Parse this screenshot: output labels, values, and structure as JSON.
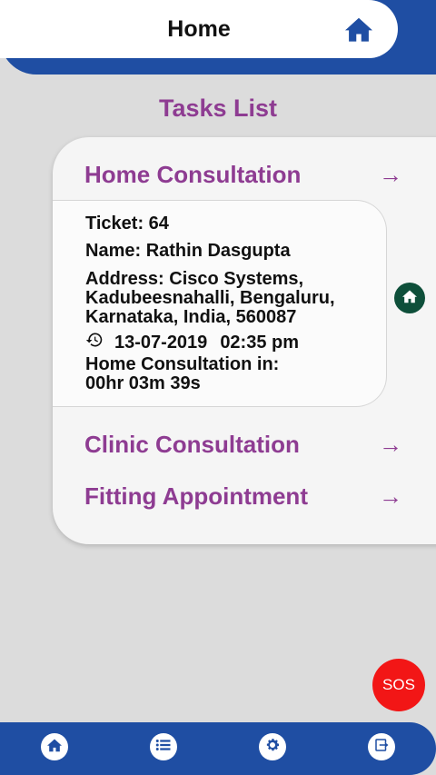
{
  "header": {
    "title": "Home",
    "home_icon": "home-icon"
  },
  "tasks": {
    "title": "Tasks List",
    "items": [
      {
        "label": "Home Consultation",
        "arrow": "→"
      },
      {
        "label": "Clinic Consultation",
        "arrow": "→"
      },
      {
        "label": "Fitting Appointment",
        "arrow": "→"
      }
    ]
  },
  "ticket": {
    "ticket": "Ticket: 64",
    "name": "Name: Rathin Dasgupta",
    "address_lines": [
      "Address: Cisco Systems,",
      "Kadubeesnahalli, Bengaluru,",
      "Karnataka, India, 560087"
    ],
    "date": "13-07-2019",
    "time": "02:35 pm",
    "countdown_label": "Home Consultation in:",
    "countdown_value": "00hr 03m 39s"
  },
  "sos": {
    "label": "SOS",
    "color": "#f21616"
  },
  "bottom_nav": [
    "home-icon",
    "list-icon",
    "settings-icon",
    "logout-icon"
  ],
  "colors": {
    "primary": "#1f4ea3",
    "accent": "#8e3c92",
    "side_button": "#0e4f3a"
  }
}
